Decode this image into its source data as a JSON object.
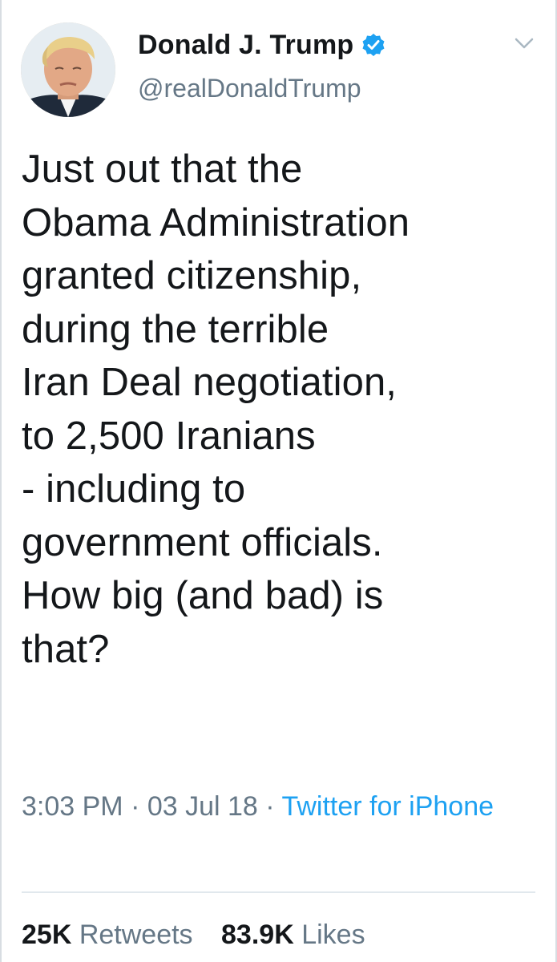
{
  "user": {
    "display_name": "Donald J. Trump",
    "handle": "@realDonaldTrump",
    "verified": true,
    "verified_icon": "verified-badge-icon"
  },
  "tweet": {
    "text": "Just out that the\nObama Administration\ngranted citizenship,\nduring the terrible\nIran Deal negotiation,\nto 2,500 Iranians\n- including to\ngovernment officials.\nHow big (and bad) is\nthat?",
    "time": "3:03 PM",
    "separator": " · ",
    "date": "03 Jul 18",
    "source": "Twitter for iPhone"
  },
  "stats": {
    "retweets_count": "25K",
    "retweets_label": "Retweets",
    "likes_count": "83.9K",
    "likes_label": "Likes"
  },
  "colors": {
    "text": "#14171a",
    "secondary": "#657786",
    "link": "#1da1f2",
    "divider": "#e1e8ed"
  },
  "icons": {
    "menu": "chevron-down-icon"
  }
}
